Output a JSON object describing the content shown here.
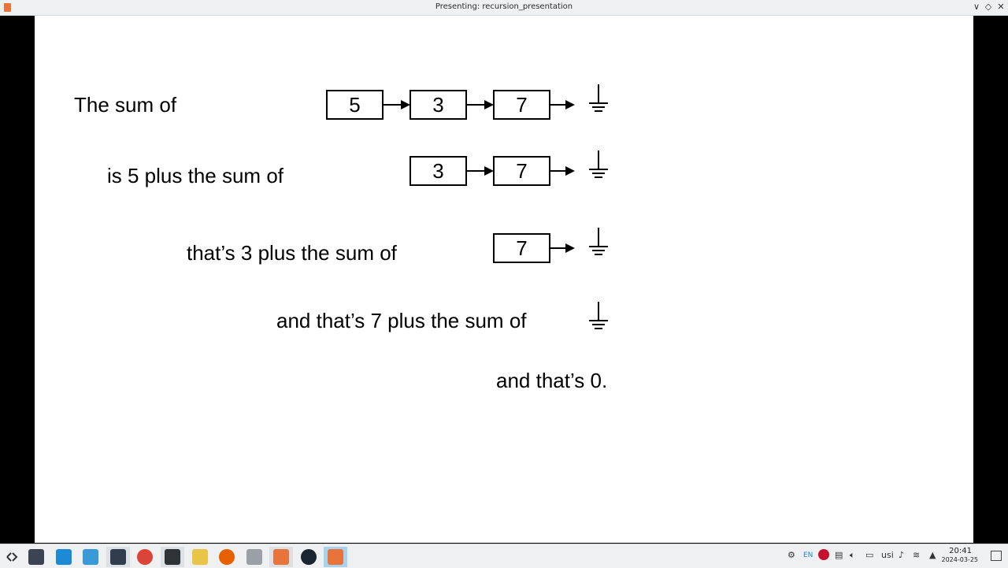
{
  "window": {
    "title": "Presenting: recursion_presentation",
    "controls": {
      "minimize": "∨",
      "restore": "◇",
      "close": "✕"
    }
  },
  "slide": {
    "lines": [
      {
        "text": "The sum of",
        "values": [
          "5",
          "3",
          "7"
        ]
      },
      {
        "text": "is 5 plus the sum of",
        "values": [
          "3",
          "7"
        ]
      },
      {
        "text": "that’s 3 plus the sum of",
        "values": [
          "7"
        ]
      },
      {
        "text": "and that’s 7 plus the sum of",
        "values": []
      }
    ],
    "final": "and that’s 0.",
    "null_symbol": "ground-icon"
  },
  "taskbar": {
    "launcher_icon": "application-launcher-icon",
    "apps": [
      {
        "name": "dashboard-icon",
        "color": "#3b4452",
        "state": "none"
      },
      {
        "name": "app-store-icon",
        "color": "#1d8ad6",
        "state": "none"
      },
      {
        "name": "file-manager-icon",
        "color": "#3a9ad9",
        "state": "none"
      },
      {
        "name": "vscode-icon",
        "color": "#2f3d4f",
        "state": "open"
      },
      {
        "name": "chrome-icon",
        "color": "#db4437",
        "state": "none"
      },
      {
        "name": "terminal-icon",
        "color": "#2e3436",
        "state": "open"
      },
      {
        "name": "mascot-app-icon",
        "color": "#e8c547",
        "state": "none"
      },
      {
        "name": "firefox-icon",
        "color": "#e66000",
        "state": "none"
      },
      {
        "name": "text-editor-icon",
        "color": "#9aa0a6",
        "state": "none"
      },
      {
        "name": "impress-icon",
        "color": "#e8743b",
        "state": "open"
      },
      {
        "name": "globe-app-icon",
        "color": "#1b2530",
        "state": "none"
      },
      {
        "name": "impress-presenting-icon",
        "color": "#e8743b",
        "state": "active"
      }
    ],
    "tray": {
      "language": "EN",
      "keyboard_layout": "usi",
      "time": "20:41",
      "date": "2024-03-25"
    }
  }
}
